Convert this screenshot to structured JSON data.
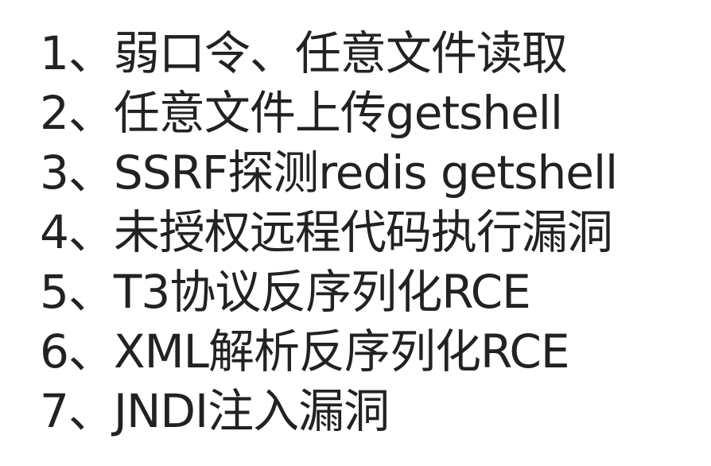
{
  "document": {
    "items": [
      "1、弱口令、任意文件读取",
      "2、任意文件上传getshell",
      "3、SSRF探测redis getshell",
      "4、未授权远程代码执行漏洞",
      "5、T3协议反序列化RCE",
      "6、XML解析反序列化RCE",
      "7、JNDI注入漏洞"
    ]
  }
}
